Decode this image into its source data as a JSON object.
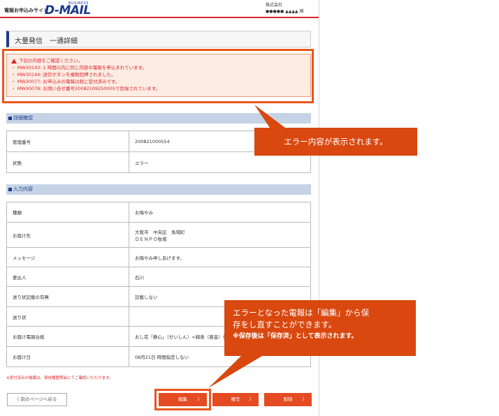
{
  "header": {
    "site_label": "電報お申込みサイト",
    "logo_business": "BUSINESS",
    "logo_text": "D-MAIL",
    "company_line1": "株式会社",
    "company_line2": "●●●●● ▲▲▲▲ 様"
  },
  "page_title": "大量発信　一通詳細",
  "errors": {
    "heading": "下記の内容をご確認ください。",
    "items": [
      "・ MW30143: 1 時間以内に同じ内容の電報を申込まれています。",
      "・ MW30144: 送信ボタンを複数回押されました。",
      "・ MW30077: お申込みの電報は既に受付済みです。",
      "・ MW30078: お問い合せ番号20082109250005で登録されています。"
    ]
  },
  "section_details": {
    "title": "詳細確認",
    "rows": [
      {
        "label": "管理番号",
        "value": "200821000554"
      },
      {
        "label": "状態",
        "value": "エラー"
      }
    ]
  },
  "section_input": {
    "title": "入力内容",
    "rows": [
      {
        "label": "種類",
        "value": "お悔やみ"
      },
      {
        "label": "お届け先",
        "value": "大阪市　中央区　馬場町",
        "value2": "ＤＥＮＰＯ牧場"
      },
      {
        "label": "メッセージ",
        "value": "お悔やみ申しあげます。"
      },
      {
        "label": "差出人",
        "value": "石川"
      },
      {
        "label": "送り状記載の有無",
        "value": "記載しない"
      },
      {
        "label": "送り状",
        "value": ""
      },
      {
        "label": "お届け電報台紙",
        "value": "おし花「静心」（せいしん）<線香（喪皇）付き>"
      },
      {
        "label": "お届け日",
        "value": "08月21日 時間指定しない"
      }
    ]
  },
  "note": "※受付済みの電報は、発信履歴照会にてご確認いただけます。",
  "buttons": {
    "back": "〈 前のページへ戻る",
    "edit": "編集",
    "copy": "複写",
    "delete": "削除",
    "arrow": "〉"
  },
  "callouts": {
    "error_shown": "エラー内容が表示されます。",
    "edit_line1": "エラーとなった電報は「編集」から保",
    "edit_line2": "存をし直すことができます。",
    "edit_sub": "※保存後は「保存済」として表示されます。"
  },
  "colors": {
    "accent": "#d9262c",
    "callout": "#d9480f",
    "highlight": "#e8571c",
    "brand_blue": "#1a3a8a",
    "section_bar": "#c6d3e6"
  }
}
